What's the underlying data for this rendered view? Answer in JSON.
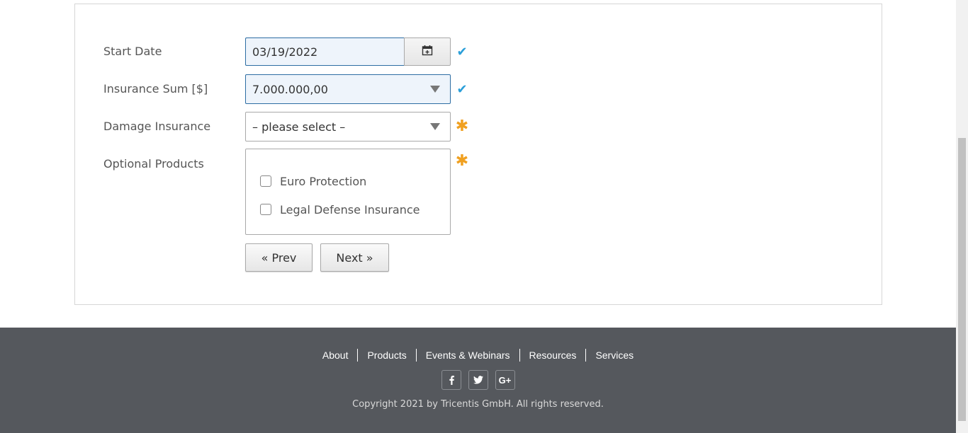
{
  "form": {
    "start_date": {
      "label": "Start Date",
      "value": "03/19/2022"
    },
    "insurance_sum": {
      "label": "Insurance Sum [$]",
      "value": "7.000.000,00"
    },
    "damage_insurance": {
      "label": "Damage Insurance",
      "value": "– please select –"
    },
    "optional_products": {
      "label": "Optional Products",
      "options": [
        {
          "label": "Euro Protection",
          "checked": false
        },
        {
          "label": "Legal Defense Insurance",
          "checked": false
        }
      ]
    },
    "prev_label": "« Prev",
    "next_label": "Next »"
  },
  "status": {
    "check_color": "#2b9fd9",
    "required_color": "#f0a020"
  },
  "footer": {
    "nav": [
      "About",
      "Products",
      "Events & Webinars",
      "Resources",
      "Services"
    ],
    "social": [
      {
        "icon": "facebook-icon",
        "glyph": "f"
      },
      {
        "icon": "twitter-icon",
        "glyph": "t"
      },
      {
        "icon": "google-plus-icon",
        "glyph": "G+"
      }
    ],
    "copyright": "Copyright 2021 by Tricentis GmbH. All rights reserved."
  }
}
